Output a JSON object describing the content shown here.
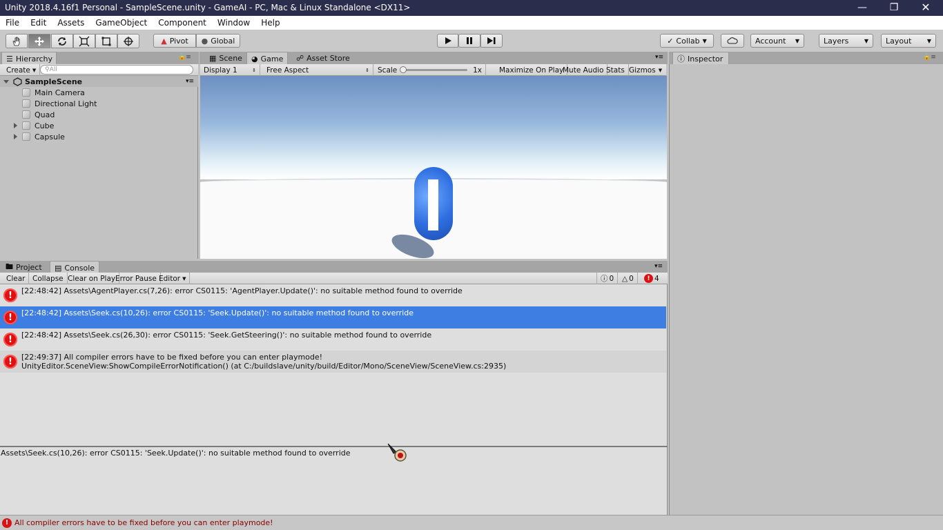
{
  "window": {
    "title": "Unity 2018.4.16f1 Personal - SampleScene.unity - GameAI - PC, Mac & Linux Standalone <DX11>"
  },
  "menubar": {
    "items": [
      "File",
      "Edit",
      "Assets",
      "GameObject",
      "Component",
      "Window",
      "Help"
    ]
  },
  "toolbar": {
    "pivot": "Pivot",
    "global": "Global",
    "collab": "Collab",
    "account": "Account",
    "layers": "Layers",
    "layout": "Layout"
  },
  "hierarchy": {
    "tab": "Hierarchy",
    "create": "Create",
    "search_placeholder": "All",
    "scene": "SampleScene",
    "items": [
      "Main Camera",
      "Directional Light",
      "Quad",
      "Cube",
      "Capsule"
    ]
  },
  "center_tabs": {
    "scene": "Scene",
    "game": "Game",
    "asset_store": "Asset Store"
  },
  "game_bar": {
    "display": "Display 1",
    "aspect": "Free Aspect",
    "scale_label": "Scale",
    "scale_value": "1x",
    "maximize": "Maximize On Play",
    "mute": "Mute Audio",
    "stats": "Stats",
    "gizmos": "Gizmos"
  },
  "inspector": {
    "tab": "Inspector"
  },
  "bottom_tabs": {
    "project": "Project",
    "console": "Console"
  },
  "console_bar": {
    "clear": "Clear",
    "collapse": "Collapse",
    "clear_on_play": "Clear on Play",
    "error_pause": "Error Pause",
    "editor": "Editor",
    "info_count": "0",
    "warn_count": "0",
    "error_count": "4"
  },
  "console": {
    "entries": [
      {
        "text": "[22:48:42] Assets\\AgentPlayer.cs(7,26): error CS0115: 'AgentPlayer.Update()': no suitable method found to override",
        "selected": false
      },
      {
        "text": "[22:48:42] Assets\\Seek.cs(10,26): error CS0115: 'Seek.Update()': no suitable method found to override",
        "selected": true
      },
      {
        "text": "[22:48:42] Assets\\Seek.cs(26,30): error CS0115: 'Seek.GetSteering()': no suitable method found to override",
        "selected": false
      },
      {
        "text": "[22:49:37] All compiler errors have to be fixed before you can enter playmode!\nUnityEditor.SceneView:ShowCompileErrorNotification() (at C:/buildslave/unity/build/Editor/Mono/SceneView/SceneView.cs:2935)",
        "selected": false
      }
    ],
    "detail": "Assets\\Seek.cs(10,26): error CS0115: 'Seek.Update()': no suitable method found to override"
  },
  "statusbar": {
    "text": "All compiler errors have to be fixed before you can enter playmode!"
  },
  "colors": {
    "title_bg": "#2b2d4c",
    "selection": "#3e7de2",
    "error": "#d11111"
  }
}
